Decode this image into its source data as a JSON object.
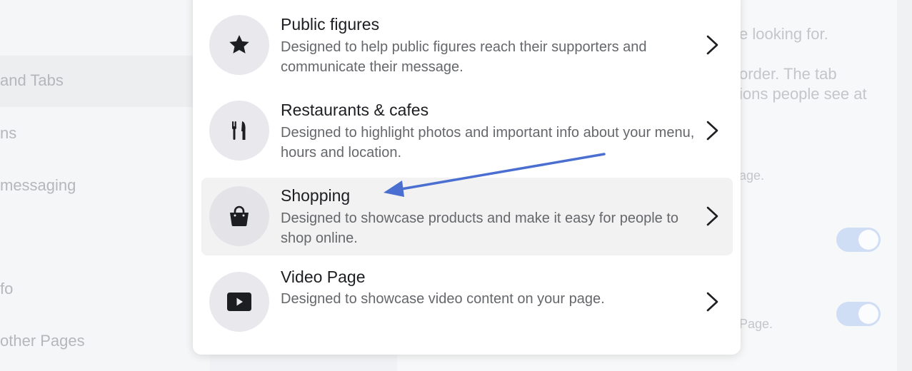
{
  "background": {
    "sidebar_items": [
      "and Tabs",
      "ns",
      "messaging",
      "fo",
      "other Pages"
    ],
    "right_texts": [
      "e looking for.",
      "order. The tab",
      "ions people see at",
      "age.",
      "Page."
    ],
    "toggles": [
      {
        "state": "on"
      },
      {
        "state": "on"
      }
    ]
  },
  "modal": {
    "options": [
      {
        "icon": "star-icon",
        "title": "Public figures",
        "description": "Designed to help public figures reach their supporters and communicate their message."
      },
      {
        "icon": "fork-knife-icon",
        "title": "Restaurants & cafes",
        "description": "Designed to highlight photos and important info about your menu, hours and location."
      },
      {
        "icon": "shopping-bag-icon",
        "title": "Shopping",
        "description": "Designed to showcase products and make it easy for people to shop online.",
        "highlighted": true
      },
      {
        "icon": "video-play-icon",
        "title": "Video Page",
        "description": "Designed to showcase video content on your page."
      }
    ]
  },
  "annotation": {
    "arrow_color": "#4a6fd1",
    "points_to": "Shopping"
  }
}
